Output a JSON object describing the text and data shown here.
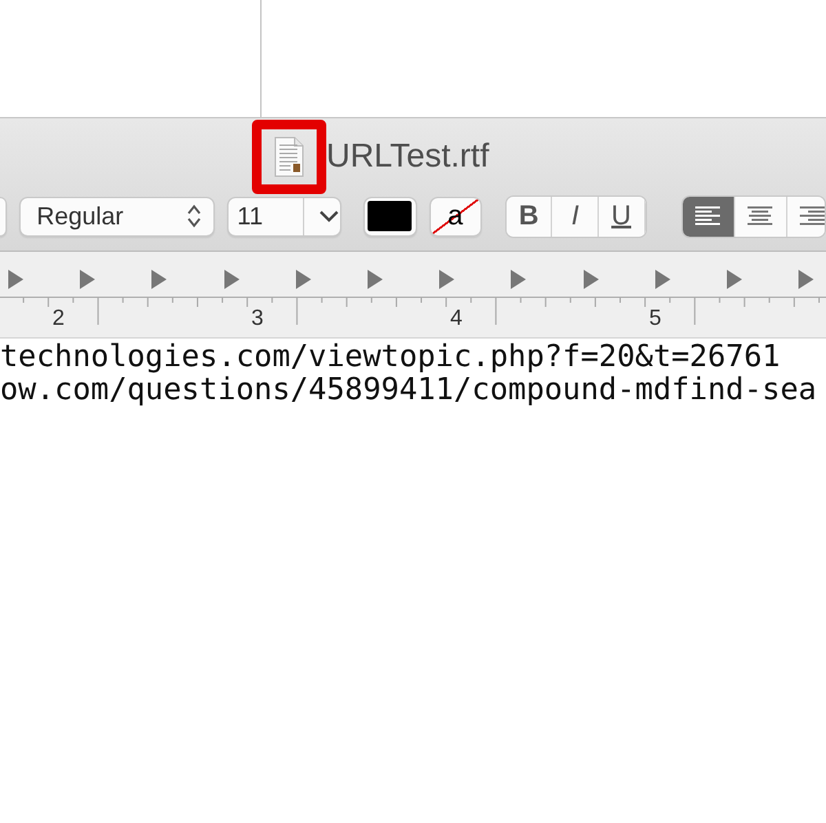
{
  "window": {
    "title": "URLTest.rtf",
    "icon_highlighted": true
  },
  "toolbar": {
    "typeface": "Regular",
    "size": "11",
    "background_glyph": "a",
    "styles": [
      {
        "label": "B",
        "kind": "bold",
        "on": false
      },
      {
        "label": "I",
        "kind": "italic",
        "on": false
      },
      {
        "label": "U",
        "kind": "underline",
        "on": false
      }
    ],
    "alignment": [
      {
        "kind": "left",
        "selected": true
      },
      {
        "kind": "center",
        "selected": false
      },
      {
        "kind": "right",
        "selected": false
      }
    ]
  },
  "ruler": {
    "numbers": [
      "2",
      "3",
      "4",
      "5"
    ]
  },
  "document": {
    "lines": [
      "technologies.com/viewtopic.php?f=20&t=26761",
      "ow.com/questions/45899411/compound-mdfind-sea"
    ]
  }
}
